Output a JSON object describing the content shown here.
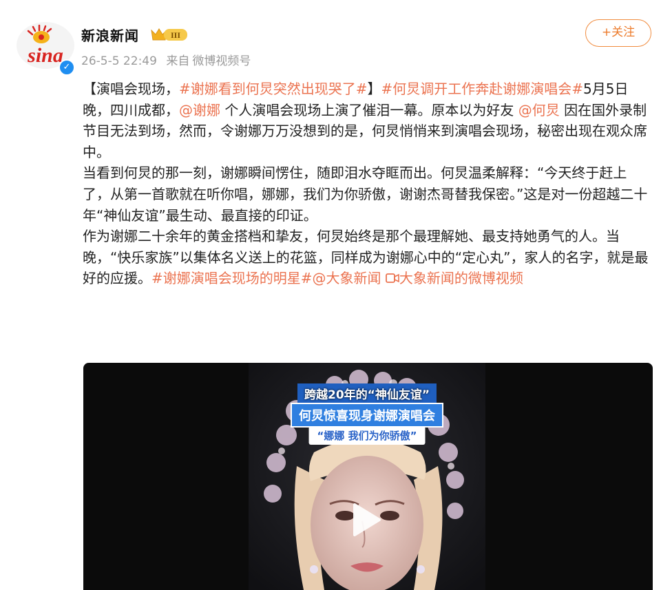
{
  "header": {
    "logo_text": "sina",
    "account_name": "新浪新闻",
    "level_badge": "III",
    "verified": true,
    "post_date": "26-5-5 22:49",
    "source_prefix": "来自",
    "source": "微博视频号",
    "follow_label": "+关注"
  },
  "post": {
    "p1_a": "【演唱会现场，",
    "p1_topic1": "#谢娜看到何炅突然出现哭了#",
    "p1_b": "】",
    "p1_topic2": "#何炅调开工作奔赴谢娜演唱会#",
    "p1_c": "5月5日晚，四川成都，",
    "p1_mention1": "@谢娜",
    "p1_d": " 个人演唱会现场上演了催泪一幕。原本以为好友 ",
    "p1_mention2": "@何炅",
    "p1_e": " 因在国外录制节目无法到场，然而，令谢娜万万没想到的是，何炅悄悄来到演唱会现场，秘密出现在观众席中。",
    "p2": "当看到何炅的那一刻，谢娜瞬间愣住，随即泪水夺眶而出。何炅温柔解释：“今天终于赶上了，从第一首歌就在听你唱，娜娜，我们为你骄傲，谢谢杰哥替我保密。”这是对一份超越二十年“神仙友谊”最生动、最直接的印证。",
    "p3_a": "作为谢娜二十余年的黄金搭档和挚友，何炅始终是那个最理解她、最支持她勇气的人。当晚，“快乐家族”以集体名义送上的花篮，同样成为谢娜心中的“定心丸”，家人的名字，就是最好的应援。",
    "p3_topic": "#谢娜演唱会现场的明星#",
    "p3_mention": "@大象新闻",
    "p3_video_icon": "video-link-icon",
    "p3_video_link": "大象新闻的微博视频"
  },
  "video": {
    "caption_1": "跨越20年的“神仙友谊”",
    "caption_2": "何炅惊喜现身谢娜演唱会",
    "caption_3": "“娜娜 我们为你骄傲”",
    "play_icon": "play-icon"
  },
  "colors": {
    "link": "#eb7350",
    "follow": "#ec7a2a",
    "verified": "#1f8ef1",
    "logo_red": "#d8231f",
    "logo_yellow": "#f5b21a"
  }
}
